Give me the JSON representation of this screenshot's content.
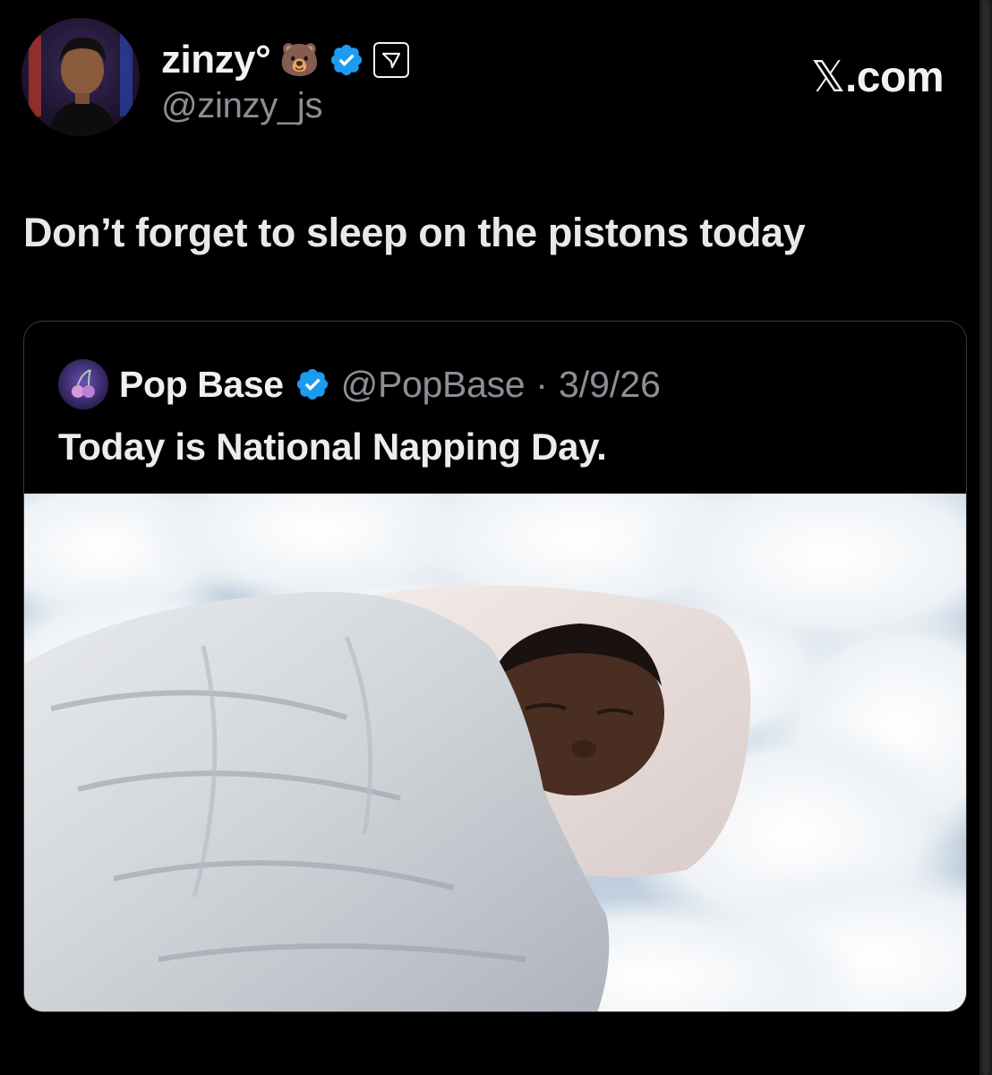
{
  "author": {
    "display_name": "zinzy°",
    "emoji": "🐻",
    "handle": "@zinzy_js"
  },
  "site": {
    "label_suffix": ".com",
    "icon": "x-logo-icon"
  },
  "tweet": {
    "text": "Don’t forget to sleep on the pistons today"
  },
  "quoted": {
    "name": "Pop Base",
    "handle": "@PopBase",
    "separator": "·",
    "date": "3/9/26",
    "text": "Today is National Napping Day.",
    "media": "photo of a man sleeping under a white comforter on a bed of clouds"
  },
  "colors": {
    "background": "#000000",
    "verified_blue": "#1d9bf0",
    "muted_text": "#8b8f95"
  }
}
